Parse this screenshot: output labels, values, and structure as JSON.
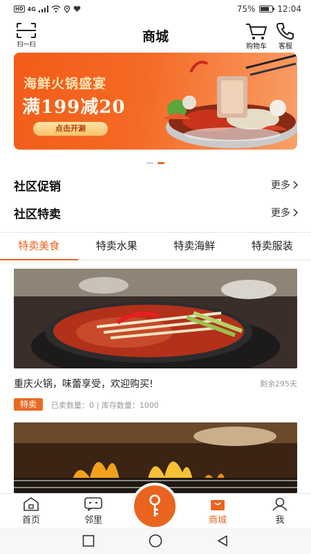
{
  "status_bar": {
    "left_icons": [
      "hd-icon",
      "signal-4g-icon",
      "signal-bars-icon",
      "wifi-icon",
      "location-icon",
      "heart-icon"
    ],
    "hd": "HD",
    "net": "4G",
    "battery_percent": "75%",
    "battery_level": 0.75,
    "time": "12:04"
  },
  "header": {
    "scan_label": "扫一扫",
    "title": "商城",
    "cart_label": "购物车",
    "service_label": "客服"
  },
  "banner": {
    "line1": "海鲜火锅盛宴",
    "line2": "满199减20",
    "cta": "点击开涮",
    "page_count": 2,
    "active_page": 2
  },
  "sections": [
    {
      "title": "社区促销",
      "more": "更多"
    },
    {
      "title": "社区特卖",
      "more": "更多"
    }
  ],
  "tabs": [
    {
      "label": "特卖美食",
      "active": true
    },
    {
      "label": "特卖水果",
      "active": false
    },
    {
      "label": "特卖海鲜",
      "active": false
    },
    {
      "label": "特卖服装",
      "active": false
    }
  ],
  "products": [
    {
      "title": "重庆火锅，味蕾享受，欢迎购买!",
      "remaining": "剩余295天",
      "badge": "特卖",
      "stats": "已卖数量：0 | 库存数量：1000"
    }
  ],
  "bottom_nav": [
    {
      "label": "首页",
      "icon": "home-icon",
      "active": false
    },
    {
      "label": "邻里",
      "icon": "chat-icon",
      "active": false
    },
    {
      "label": "",
      "icon": "key-icon",
      "active": false
    },
    {
      "label": "商城",
      "icon": "shopping-bag-icon",
      "active": true
    },
    {
      "label": "我",
      "icon": "user-icon",
      "active": false
    }
  ],
  "colors": {
    "accent": "#e9641f",
    "banner": "#f25c19",
    "badge": "#ea6a24"
  }
}
